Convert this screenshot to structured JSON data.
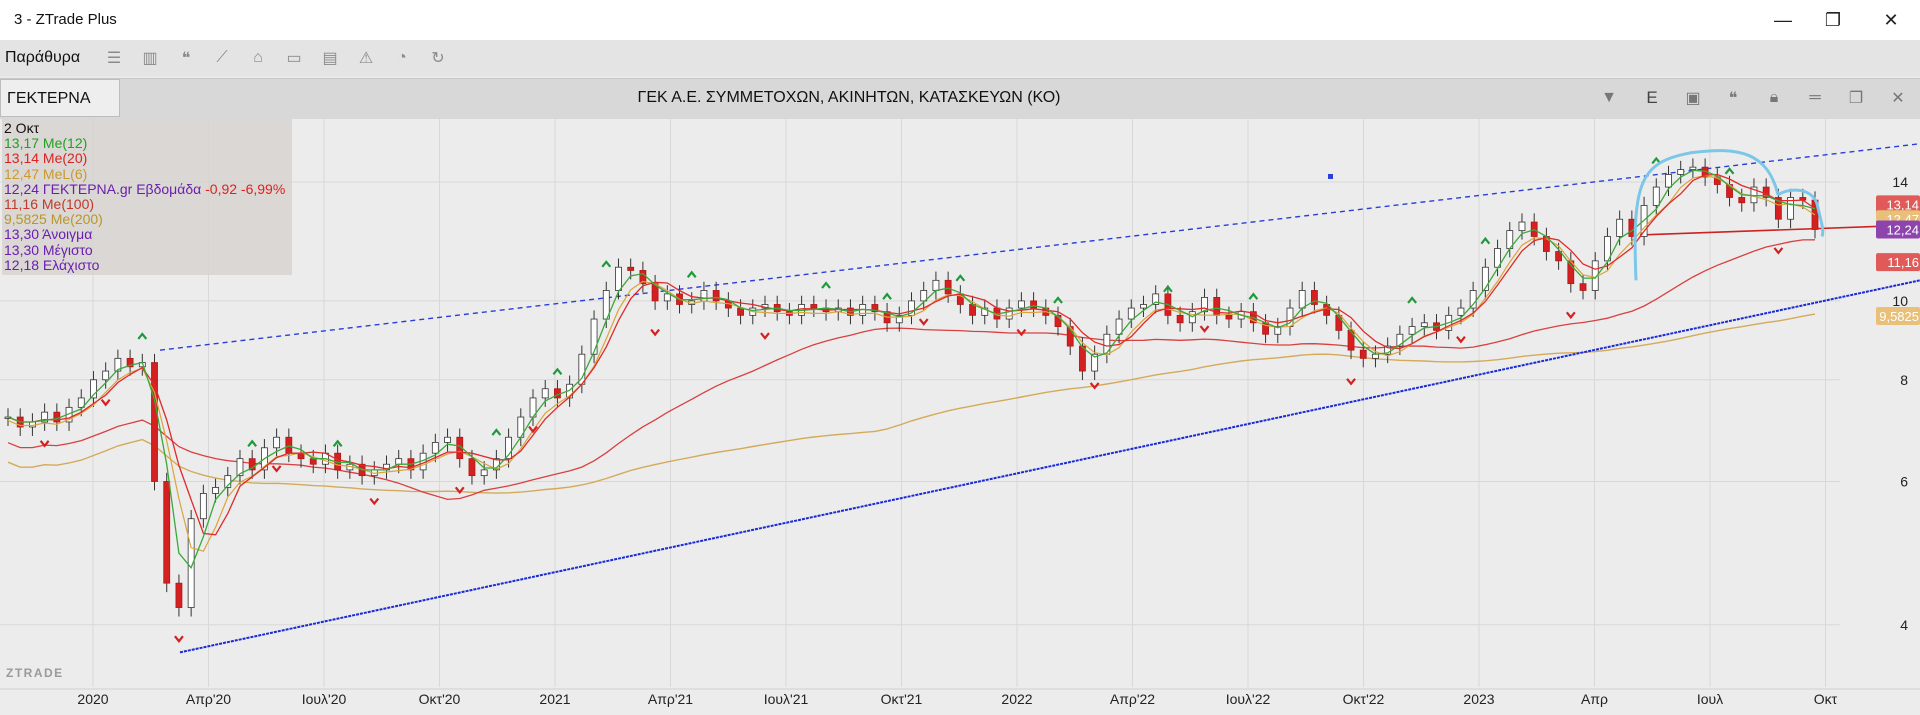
{
  "window": {
    "title": "3 - ZTrade Plus",
    "minimize": "—",
    "restore": "❐",
    "close": "✕"
  },
  "toolbar": {
    "menu_label": "Παράθυρα",
    "icons": [
      "list-icon",
      "book-icon",
      "chat-icon",
      "chart-line-icon",
      "bank-icon",
      "inbox-icon",
      "clipboard-icon",
      "warning-icon",
      "rss-icon",
      "refresh-icon"
    ]
  },
  "symbol_bar": {
    "symbol": "ΓΕΚΤΕΡΝΑ",
    "company": "ΓΕΚ  Α.Ε. ΣΥΜΜΕΤΟΧΩΝ, ΑΚΙΝΗΤΩΝ, ΚΑΤΑΣΚΕΥΩΝ (ΚΟ)",
    "e_label": "E"
  },
  "legend": {
    "date": "2 Οκτ",
    "lines": [
      {
        "text": "13,17 Me(12)",
        "color": "#22a022"
      },
      {
        "text": "13,14 Me(20)",
        "color": "#dd2222"
      },
      {
        "text": "12,47 MeL(6)",
        "color": "#c89a30"
      },
      {
        "text_main": "12,24 ΓΕΚΤΕΡΝΑ.gr Εβδομάδα ",
        "text_change": "-0,92 -6,99%",
        "color": "#6a1fb0",
        "change_color": "#dd2222"
      },
      {
        "text": "11,16 Me(100)",
        "color": "#c0392b"
      },
      {
        "text": "9,5825 Me(200)",
        "color": "#b8962e"
      },
      {
        "text": "13,30 Άνοιγμα",
        "color": "#6a1fb0"
      },
      {
        "text": "13,30 Μέγιστο",
        "color": "#6a1fb0"
      },
      {
        "text": "12,18 Ελάχιστο",
        "color": "#6a1fb0"
      }
    ]
  },
  "watermark": "ZTRADE",
  "price_tags": [
    {
      "label": "13,14",
      "value": 13.14,
      "color": "#e05a5a"
    },
    {
      "label": "12,47",
      "value": 12.6,
      "color": "#e8c07a"
    },
    {
      "label": "12,24",
      "value": 12.24,
      "color": "#8e44ad"
    },
    {
      "label": "11,16",
      "value": 11.16,
      "color": "#e05a5a"
    },
    {
      "label": "9,5825",
      "value": 9.5825,
      "color": "#e8c07a"
    }
  ],
  "chart_data": {
    "type": "candlestick",
    "y_ticks": [
      "14",
      "10",
      "8",
      "6",
      "4"
    ],
    "y_tick_values": [
      14,
      10,
      8,
      6,
      4
    ],
    "ylim": [
      3.5,
      15.9
    ],
    "y_scale": "log",
    "x_tick_labels": [
      "2020",
      "Απρ'20",
      "Ιουλ'20",
      "Οκτ'20",
      "2021",
      "Απρ'21",
      "Ιουλ'21",
      "Οκτ'21",
      "2022",
      "Απρ'22",
      "Ιουλ'22",
      "Οκτ'22",
      "2023",
      "Απρ",
      "Ιουλ",
      "Οκτ"
    ],
    "series_close": [
      7.2,
      7.0,
      7.1,
      7.3,
      7.1,
      7.4,
      7.6,
      8.0,
      8.2,
      8.5,
      8.3,
      8.4,
      6.0,
      4.5,
      4.2,
      5.4,
      5.8,
      5.9,
      6.1,
      6.4,
      6.2,
      6.6,
      6.8,
      6.5,
      6.4,
      6.3,
      6.5,
      6.2,
      6.3,
      6.1,
      6.2,
      6.3,
      6.4,
      6.2,
      6.5,
      6.7,
      6.8,
      6.4,
      6.1,
      6.2,
      6.4,
      6.8,
      7.2,
      7.6,
      7.8,
      7.6,
      7.9,
      8.6,
      9.5,
      10.3,
      11.0,
      10.9,
      10.5,
      10.0,
      10.2,
      9.9,
      10.0,
      10.3,
      10.0,
      9.8,
      9.6,
      9.8,
      9.9,
      9.7,
      9.6,
      9.9,
      9.8,
      9.7,
      9.8,
      9.6,
      9.9,
      9.7,
      9.4,
      9.6,
      10.0,
      10.3,
      10.6,
      10.2,
      9.9,
      9.6,
      9.8,
      9.5,
      9.8,
      10.0,
      9.8,
      9.6,
      9.3,
      8.8,
      8.2,
      8.6,
      9.1,
      9.5,
      9.8,
      9.9,
      10.2,
      9.6,
      9.4,
      9.7,
      10.1,
      9.6,
      9.5,
      9.7,
      9.4,
      9.1,
      9.3,
      9.8,
      10.3,
      9.9,
      9.6,
      9.2,
      8.7,
      8.5,
      8.6,
      8.8,
      9.1,
      9.3,
      9.4,
      9.2,
      9.6,
      9.8,
      10.3,
      11.0,
      11.6,
      12.2,
      12.5,
      12.0,
      11.5,
      11.2,
      10.5,
      10.3,
      11.2,
      12.0,
      12.6,
      12.0,
      13.1,
      13.8,
      14.3,
      14.5,
      14.6,
      14.2,
      13.9,
      13.4,
      13.2,
      13.8,
      13.4,
      12.6,
      13.4,
      13.3,
      12.24
    ]
  }
}
